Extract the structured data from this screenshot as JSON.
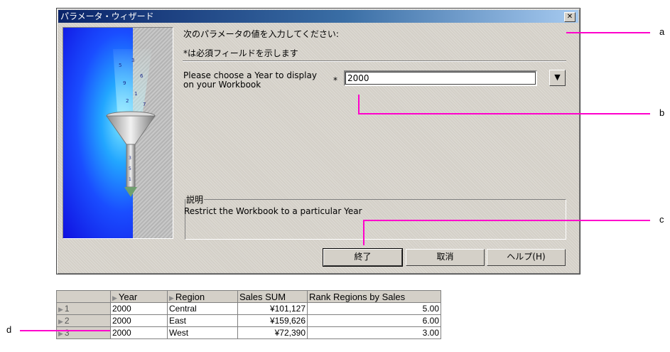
{
  "dialog": {
    "title": "パラメータ・ウィザード",
    "close_glyph": "✕",
    "header_line1": "次のパラメータの値を入力してください:",
    "header_line2": "*は必須フィールドを示します",
    "prompt": "Please choose a Year to display on your Workbook",
    "required_mark": "*",
    "year_value": "2000",
    "dropdown_icon": "▼",
    "description_label": "説明",
    "description_text": "Restrict the Workbook to a particular Year",
    "buttons": {
      "finish": "終了",
      "cancel": "取消",
      "help": "ヘルプ(H)"
    }
  },
  "table": {
    "headers": [
      "Year",
      "Region",
      "Sales SUM",
      "Rank Regions by Sales"
    ],
    "rows": [
      {
        "num": "1",
        "year": "2000",
        "region": "Central",
        "sales": "¥101,127",
        "rank": "5.00"
      },
      {
        "num": "2",
        "year": "2000",
        "region": "East",
        "sales": "¥159,626",
        "rank": "6.00"
      },
      {
        "num": "3",
        "year": "2000",
        "region": "West",
        "sales": "¥72,390",
        "rank": "3.00"
      }
    ]
  },
  "callouts": {
    "a": "a",
    "b": "b",
    "c": "c",
    "d": "d"
  },
  "colors": {
    "callout": "#ff00cc",
    "title_bar": "#0a246a",
    "dialog_bg": "#d4d0c8"
  }
}
